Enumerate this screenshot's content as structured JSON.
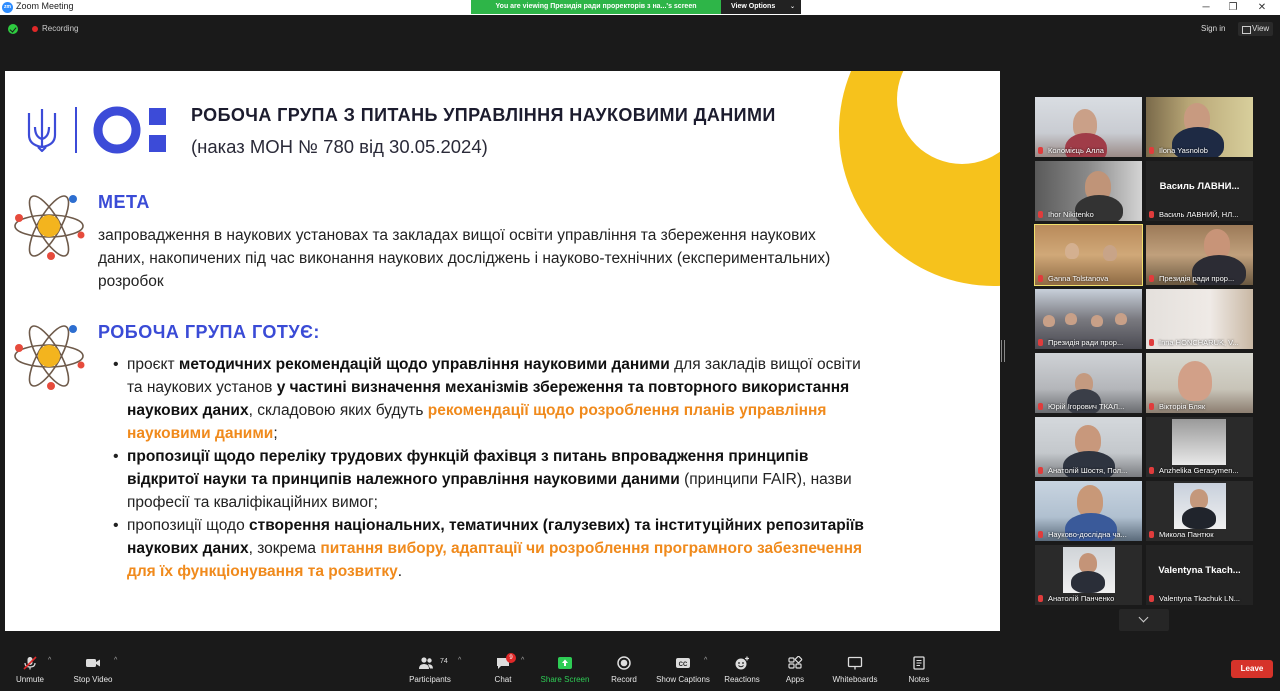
{
  "window": {
    "title": "Zoom Meeting",
    "logo_text": "zm",
    "minimize": "─",
    "maximize": "❐",
    "close": "✕"
  },
  "share_banner": {
    "text": "You are viewing Президія ради проректорів з на...'s screen",
    "view_options": "View Options",
    "caret": "⌄"
  },
  "status": {
    "recording": "Recording",
    "sign_in": "Sign in",
    "view": "View"
  },
  "slide": {
    "title": "РОБОЧА ГРУПА З ПИТАНЬ УПРАВЛІННЯ НАУКОВИМИ ДАНИМИ",
    "subtitle": "(наказ МОН № 780 від 30.05.2024)",
    "goal_heading": "МЕТА",
    "goal_text": "запровадження в наукових установах та закладах вищої освіти управління та збереження наукових даних, накопичених під час виконання наукових досліджень і науково-технічних (експериментальних) розробок",
    "prepares_heading": "РОБОЧА ГРУПА ГОТУЄ:",
    "bullets": [
      {
        "p1": "проєкт ",
        "b1": "методичних рекомендацій щодо управління науковими даними",
        "p2": " для закладів вищої освіти та наукових установ ",
        "b2": "у частині визначення механізмів збереження та повторного використання наукових даних",
        "p3": ", складовою яких будуть ",
        "o1": "рекомендації щодо розроблення планів управління науковими даними",
        "p4": ";"
      },
      {
        "b1": "пропозиції щодо переліку трудових функцій фахівця з питань впровадження принципів відкритої науки та принципів належного управління науковими даними",
        "p1": " (принципи FAIR), назви професії та кваліфікаційних вимог;"
      },
      {
        "p1": "пропозиції щодо ",
        "b1": "створення національних, тематичних (галузевих) та інституційних репозитаріїв наукових даних",
        "p2": ", зокрема ",
        "o1": "питання вибору, адаптації чи розроблення програмного забезпечення для їх функціонування та розвитку",
        "p3": "."
      }
    ]
  },
  "participants": [
    {
      "name": "Коломієць Алла"
    },
    {
      "name": "Ilona Yasnolob"
    },
    {
      "name": "Ihor Nikitenko"
    },
    {
      "name": "Василь ЛАВНИЙ, НЛ...",
      "big": "Василь  ЛАВНИ..."
    },
    {
      "name": "Ganna Tolstanova"
    },
    {
      "name": "Президія ради прор..."
    },
    {
      "name": "Президія ради прор..."
    },
    {
      "name": "Inna HONCHARUK, V..."
    },
    {
      "name": "Юрій Ігорович ТКАЛ..."
    },
    {
      "name": "Вікторія Бляк"
    },
    {
      "name": "Анатолій Шостя, Пол..."
    },
    {
      "name": "Anzhelika Gerasymen..."
    },
    {
      "name": "Науково-дослідна ча..."
    },
    {
      "name": "Микола Пантюк"
    },
    {
      "name": "Анатолій Панченко"
    },
    {
      "name": "Valentyna Tkachuk LN...",
      "big": "Valentyna  Tkach..."
    }
  ],
  "toolbar": {
    "unmute": "Unmute",
    "stop_video": "Stop Video",
    "participants": "Participants",
    "participants_count": "74",
    "chat": "Chat",
    "chat_badge": "9",
    "share_screen": "Share Screen",
    "record": "Record",
    "show_captions": "Show Captions",
    "reactions": "Reactions",
    "apps": "Apps",
    "whiteboards": "Whiteboards",
    "notes": "Notes",
    "leave": "Leave"
  },
  "colors": {
    "accent_blue": "#3a4bd6",
    "accent_orange": "#f08a1c",
    "accent_yellow": "#f6c21c",
    "zoom_green": "#2eb548",
    "leave_red": "#d6332a"
  }
}
